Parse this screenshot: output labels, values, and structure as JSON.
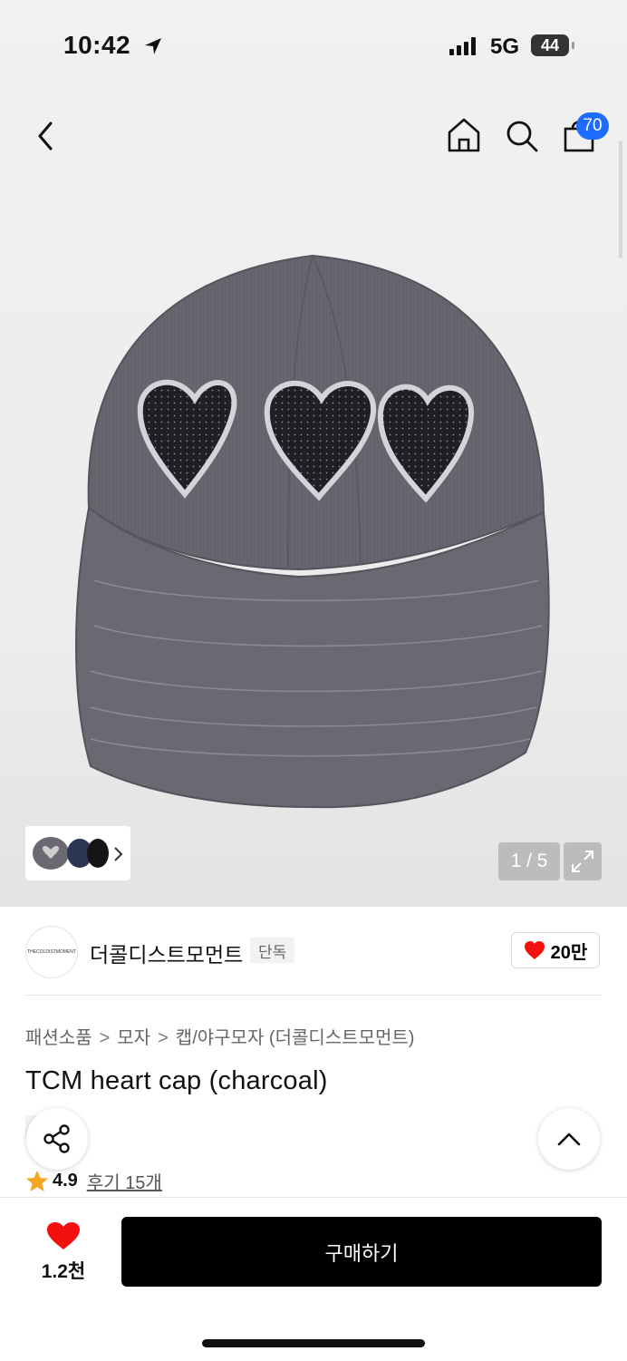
{
  "status_bar": {
    "time": "10:42",
    "network": "5G",
    "battery": "44"
  },
  "header": {
    "cart_count": "70"
  },
  "gallery": {
    "counter": "1 / 5"
  },
  "brand": {
    "logo_text": "THECOLDISTMOMENT",
    "name": "더콜디스트모먼트",
    "tag": "단독",
    "likes": "20만"
  },
  "breadcrumb": {
    "level1": "패션소품",
    "level2": "모자",
    "level3": "캡/야구모자 (더콜디스트모먼트)",
    "separator": ">"
  },
  "product": {
    "title": "TCM heart cap (charcoal)",
    "tag": "단독",
    "rating": "4.9",
    "reviews": "후기 15개"
  },
  "bottom": {
    "wish_count": "1.2천",
    "buy_label": "구매하기"
  },
  "colors": {
    "accent_red": "#f31110",
    "badge_blue": "#1e6cff",
    "cap_gray": "#66656f"
  }
}
